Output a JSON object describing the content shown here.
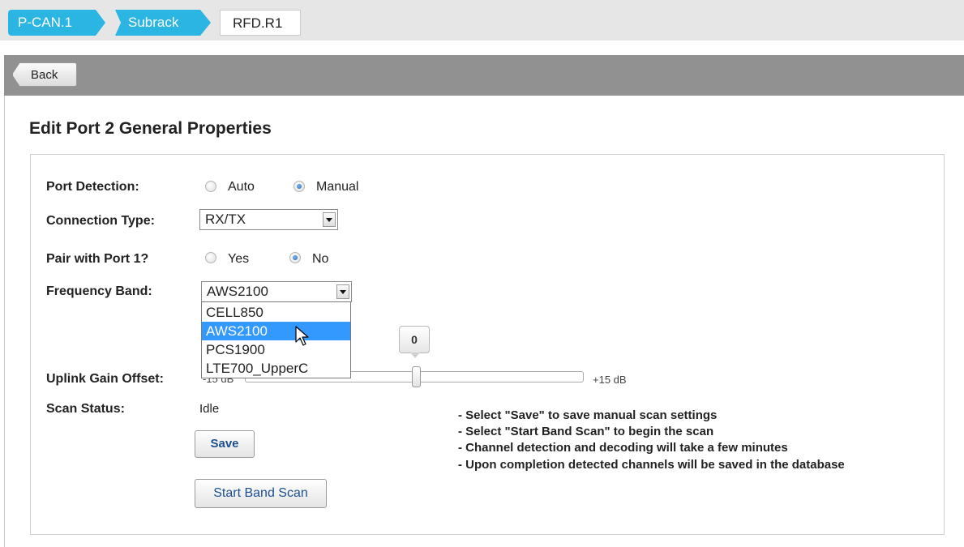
{
  "breadcrumb": {
    "items": [
      "P-CAN.1",
      "Subrack",
      "RFD.R1"
    ]
  },
  "header": {
    "back_label": "Back"
  },
  "page_title": "Edit Port 2 General Properties",
  "form": {
    "port_detection": {
      "label": "Port Detection:",
      "options": [
        "Auto",
        "Manual"
      ],
      "selected": "Manual"
    },
    "connection_type": {
      "label": "Connection Type:",
      "value": "RX/TX"
    },
    "pair_with_port": {
      "label": "Pair with Port 1?",
      "options": [
        "Yes",
        "No"
      ],
      "selected": "No"
    },
    "frequency_band": {
      "label": "Frequency Band:",
      "value": "AWS2100",
      "options": [
        "CELL850",
        "AWS2100",
        "PCS1900",
        "LTE700_UpperC"
      ],
      "highlighted": "AWS2100"
    },
    "uplink_gain_offset": {
      "label": "Uplink Gain Offset:",
      "min_label": "-15 dB",
      "max_label": "+15 dB",
      "value": "0",
      "fraction": 0.5
    },
    "scan_status": {
      "label": "Scan Status:",
      "value": "Idle"
    }
  },
  "buttons": {
    "save": "Save",
    "start_band_scan": "Start Band Scan"
  },
  "notes": [
    "- Select \"Save\" to save manual scan settings",
    "- Select \"Start Band Scan\" to begin the scan",
    "- Channel detection and decoding will take a few minutes",
    "- Upon completion detected channels will be saved in the database"
  ],
  "colors": {
    "breadcrumb_active": "#2bb5e3",
    "header_bg": "#919191",
    "selected_option": "#3399ff"
  }
}
